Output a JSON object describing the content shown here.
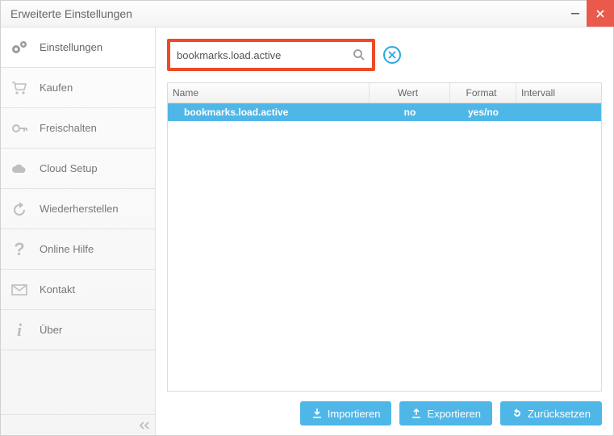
{
  "window": {
    "title": "Erweiterte Einstellungen"
  },
  "sidebar": {
    "items": [
      {
        "label": "Einstellungen"
      },
      {
        "label": "Kaufen"
      },
      {
        "label": "Freischalten"
      },
      {
        "label": "Cloud Setup"
      },
      {
        "label": "Wiederherstellen"
      },
      {
        "label": "Online Hilfe"
      },
      {
        "label": "Kontakt"
      },
      {
        "label": "Über"
      }
    ]
  },
  "search": {
    "value": "bookmarks.load.active"
  },
  "table": {
    "columns": {
      "name": "Name",
      "wert": "Wert",
      "format": "Format",
      "intervall": "Intervall"
    },
    "rows": [
      {
        "name": "bookmarks.load.active",
        "wert": "no",
        "format": "yes/no",
        "intervall": ""
      }
    ]
  },
  "actions": {
    "import": "Importieren",
    "export": "Exportieren",
    "reset": "Zurücksetzen"
  }
}
